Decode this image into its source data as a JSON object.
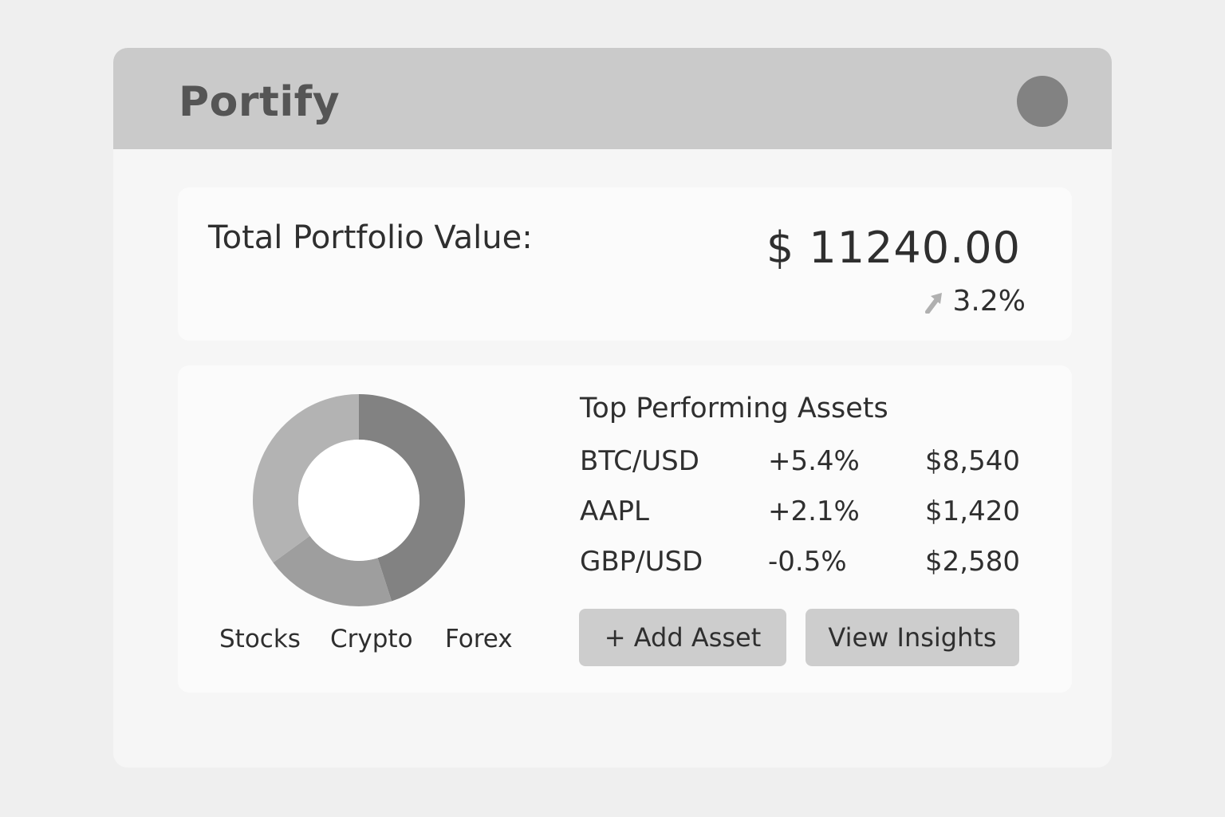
{
  "header": {
    "app_title": "Portify",
    "avatar_icon": "user-avatar-icon"
  },
  "portfolio": {
    "total_label": "Total Portfolio Value:",
    "total_value": "$ 11240.00",
    "change": "3.2%",
    "change_icon": "arrow-up-right-icon"
  },
  "allocation": {
    "legend": [
      "Stocks",
      "Crypto",
      "Forex"
    ],
    "colors": [
      "#828282",
      "#9e9e9e",
      "#b3b3b3"
    ]
  },
  "top_assets": {
    "title": "Top Performing Assets",
    "rows": [
      {
        "name": "BTC/USD",
        "change": "+5.4%",
        "value": "$8,540"
      },
      {
        "name": "AAPL",
        "change": "+2.1%",
        "value": "$1,420"
      },
      {
        "name": "GBP/USD",
        "change": "-0.5%",
        "value": "$2,580"
      }
    ]
  },
  "actions": {
    "add_asset": "+ Add Asset",
    "view_insights": "View Insights"
  },
  "chart_data": {
    "type": "pie",
    "categories": [
      "Stocks",
      "Crypto",
      "Forex"
    ],
    "values": [
      45,
      20,
      35
    ]
  }
}
